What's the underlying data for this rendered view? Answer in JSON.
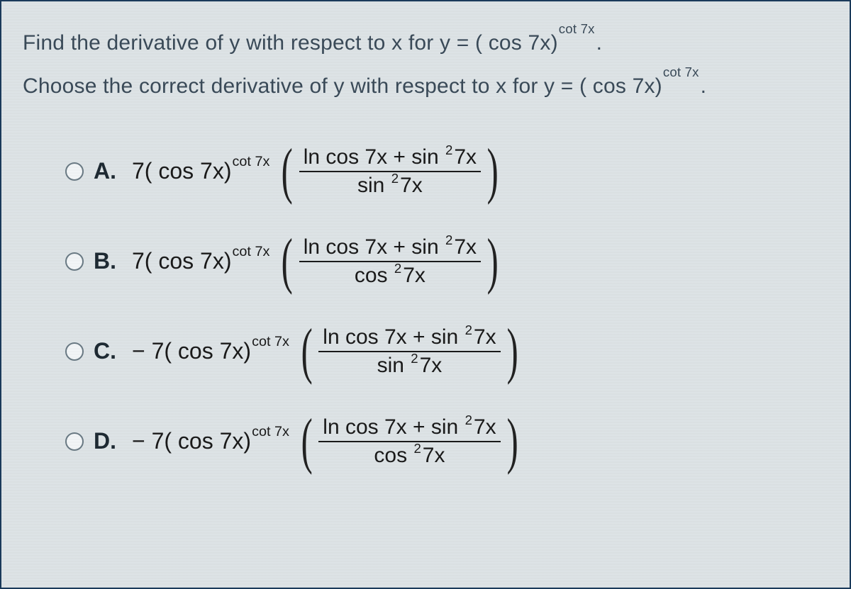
{
  "question": {
    "prompt_prefix": "Find the derivative of y with respect to x for y = ( cos 7x)",
    "prompt_exp": "cot 7x",
    "subprompt_prefix": "Choose the correct derivative of y with respect to x for y = ( cos 7x)",
    "subprompt_exp": "cot 7x"
  },
  "common": {
    "coef_pos": "7( cos 7x)",
    "coef_neg": "− 7( cos 7x)",
    "exp": "cot 7x",
    "numerator_1": "ln cos 7x + sin",
    "numerator_sup": "2",
    "numerator_2": "7x",
    "denom_sin_1": "sin",
    "denom_sin_sup": "2",
    "denom_sin_2": "7x",
    "denom_cos_1": "cos",
    "denom_cos_sup": "2",
    "denom_cos_2": "7x"
  },
  "options": {
    "a": {
      "letter": "A."
    },
    "b": {
      "letter": "B."
    },
    "c": {
      "letter": "C."
    },
    "d": {
      "letter": "D."
    }
  }
}
